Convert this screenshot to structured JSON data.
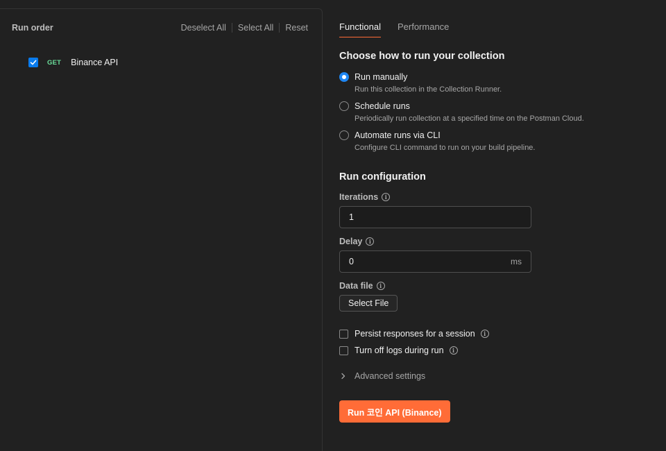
{
  "left": {
    "title": "Run order",
    "actions": [
      "Deselect All",
      "Select All",
      "Reset"
    ],
    "requests": [
      {
        "method": "GET",
        "name": "Binance API",
        "checked": true
      }
    ]
  },
  "tabs": [
    {
      "label": "Functional",
      "active": true
    },
    {
      "label": "Performance",
      "active": false
    }
  ],
  "how_to_run": {
    "title": "Choose how to run your collection",
    "options": [
      {
        "label": "Run manually",
        "desc": "Run this collection in the Collection Runner.",
        "selected": true
      },
      {
        "label": "Schedule runs",
        "desc": "Periodically run collection at a specified time on the Postman Cloud.",
        "selected": false
      },
      {
        "label": "Automate runs via CLI",
        "desc": "Configure CLI command to run on your build pipeline.",
        "selected": false
      }
    ]
  },
  "config": {
    "title": "Run configuration",
    "iterations_label": "Iterations",
    "iterations_value": "1",
    "delay_label": "Delay",
    "delay_value": "0",
    "delay_unit": "ms",
    "data_file_label": "Data file",
    "select_file_label": "Select File",
    "persist_label": "Persist responses for a session",
    "turn_off_logs_label": "Turn off logs during run",
    "advanced_label": "Advanced settings"
  },
  "run_button_label": "Run 코인 API (Binance)",
  "colors": {
    "accent": "#ff6c37",
    "radio_selected": "#1f86f2",
    "checkbox_checked": "#097bed",
    "method_get": "#6bdd9a"
  },
  "icons": {
    "info": "info-icon",
    "chevron": "chevron-right-icon",
    "check": "check-icon"
  }
}
